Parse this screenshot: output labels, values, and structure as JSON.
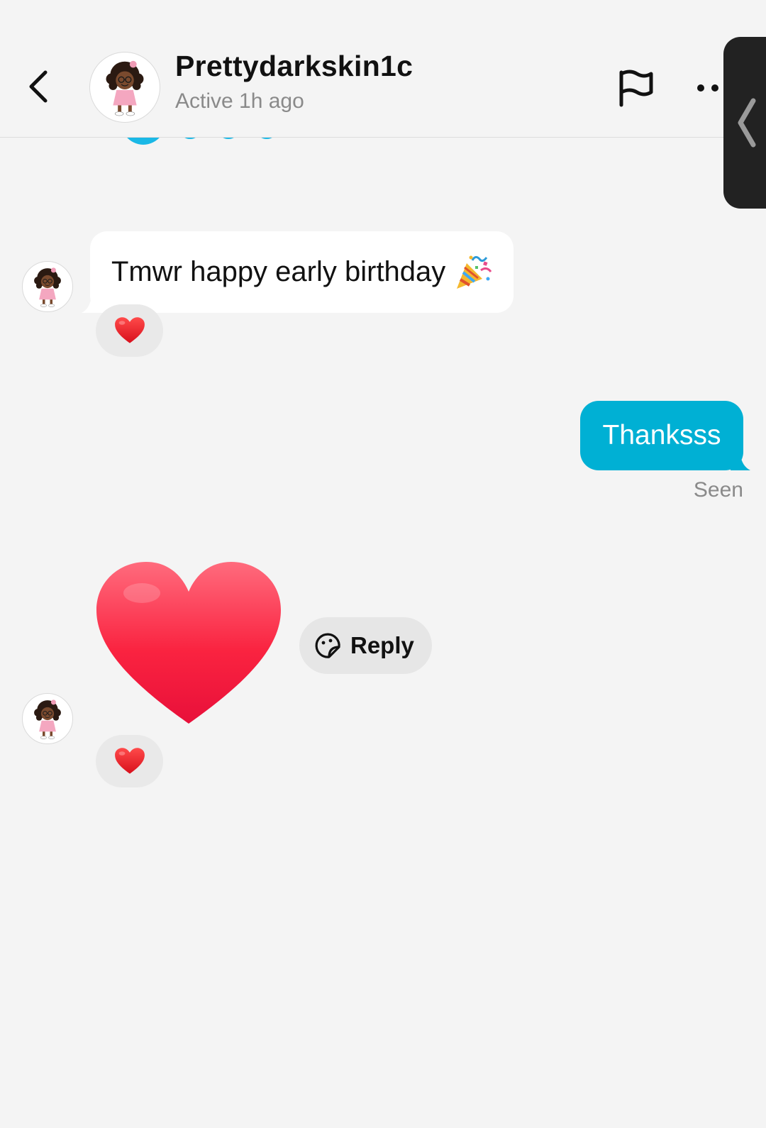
{
  "header": {
    "username": "Prettydarkskin1c",
    "status": "Active 1h ago",
    "back_icon": "chevron-left-icon",
    "flag_icon": "flag-icon",
    "more_icon": "more-horizontal-icon"
  },
  "side_panel": {
    "icon": "chevron-left-icon"
  },
  "messages": [
    {
      "direction": "incoming",
      "text": "Tmwr happy early birthday",
      "emoji_icon": "party-popper-icon",
      "reaction": "heart-emoji"
    },
    {
      "direction": "outgoing",
      "text": "Thanksss",
      "status": "Seen"
    },
    {
      "direction": "incoming",
      "type": "sticker",
      "sticker": "red-heart-sticker",
      "reaction": "heart-emoji",
      "reply_label": "Reply",
      "reply_icon": "sticker-face-icon"
    }
  ],
  "colors": {
    "background": "#f4f4f4",
    "outgoing_bubble": "#00b0d4",
    "incoming_bubble": "#ffffff",
    "reaction_pill": "#e9e9e9",
    "heart": "#f5203a"
  }
}
